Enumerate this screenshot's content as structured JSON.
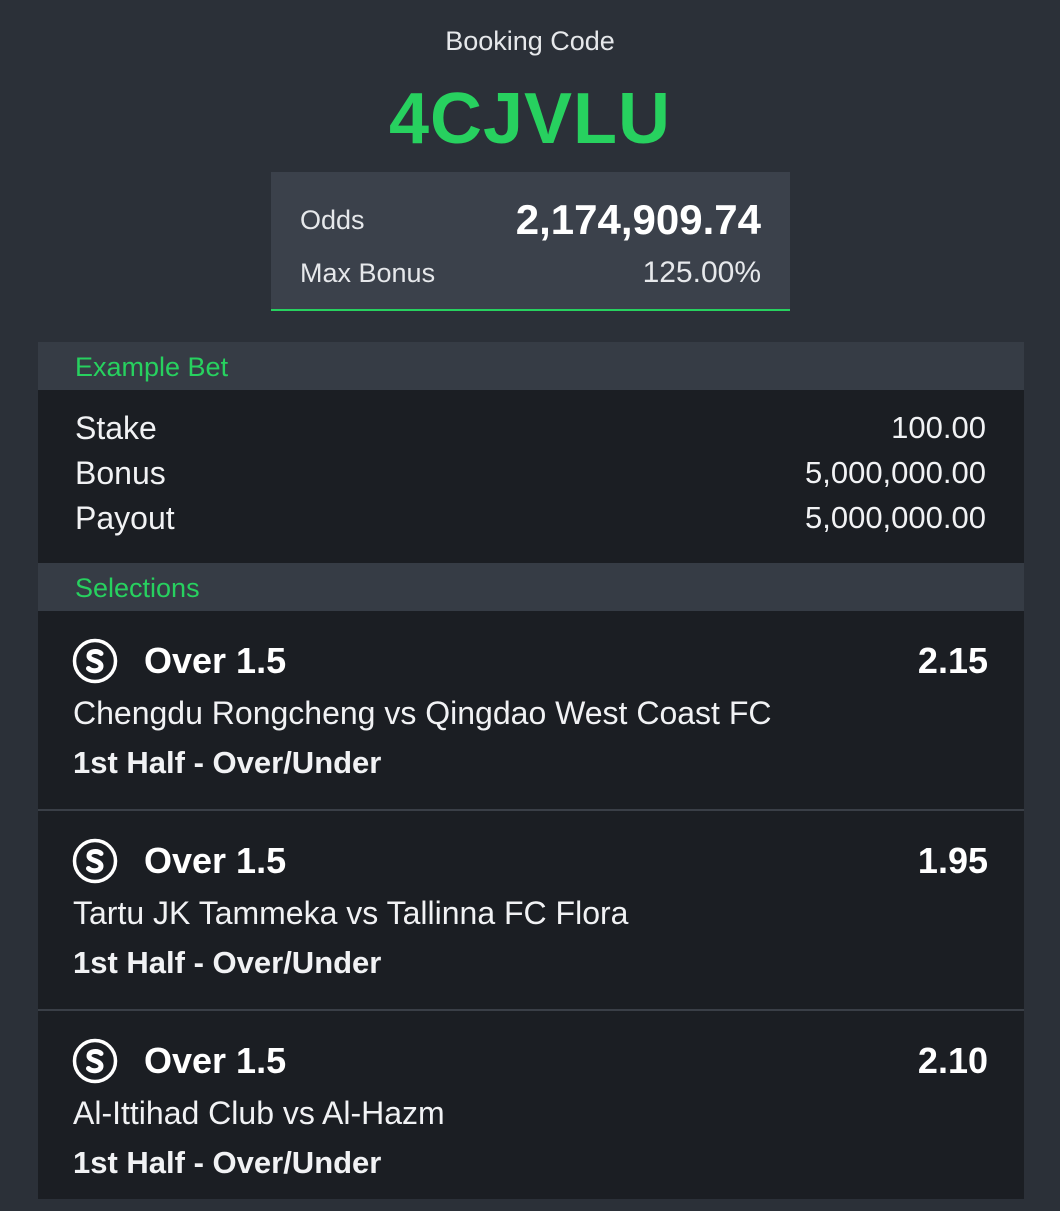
{
  "booking": {
    "label": "Booking Code",
    "code": "4CJVLU"
  },
  "summary": {
    "odds_label": "Odds",
    "odds_value": "2,174,909.74",
    "bonus_label": "Max Bonus",
    "bonus_value": "125.00%"
  },
  "example_bet": {
    "header": "Example Bet",
    "rows": [
      {
        "label": "Stake",
        "value": "100.00"
      },
      {
        "label": "Bonus",
        "value": "5,000,000.00"
      },
      {
        "label": "Payout",
        "value": "5,000,000.00"
      }
    ]
  },
  "selections": {
    "header": "Selections",
    "icon": "sport-soccer-icon",
    "items": [
      {
        "pick": "Over 1.5",
        "odd": "2.15",
        "match": "Chengdu Rongcheng vs Qingdao West Coast FC",
        "market": "1st Half - Over/Under"
      },
      {
        "pick": "Over 1.5",
        "odd": "1.95",
        "match": "Tartu JK Tammeka vs Tallinna FC Flora",
        "market": "1st Half - Over/Under"
      },
      {
        "pick": "Over 1.5",
        "odd": "2.10",
        "match": "Al-Ittihad Club vs Al-Hazm",
        "market": "1st Half - Over/Under"
      }
    ]
  },
  "colors": {
    "accent": "#27d15f",
    "background": "#2b3038",
    "card": "#1b1e23"
  }
}
